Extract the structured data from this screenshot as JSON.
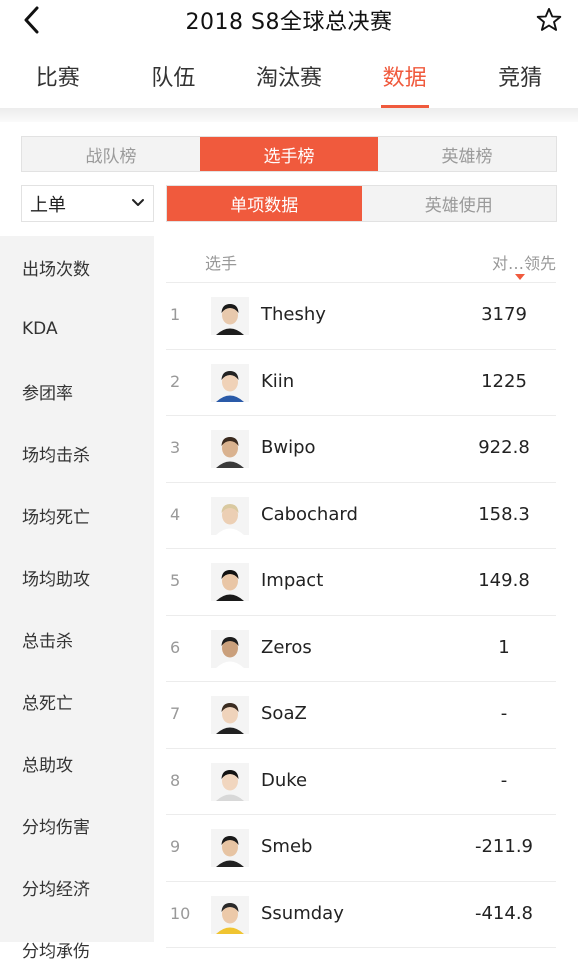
{
  "header": {
    "title": "2018 S8全球总决赛"
  },
  "main_tabs": [
    {
      "label": "比赛",
      "active": false
    },
    {
      "label": "队伍",
      "active": false
    },
    {
      "label": "淘汰赛",
      "active": false
    },
    {
      "label": "数据",
      "active": true
    },
    {
      "label": "竞猜",
      "active": false
    }
  ],
  "ranking_tabs": [
    {
      "label": "战队榜",
      "active": false
    },
    {
      "label": "选手榜",
      "active": true
    },
    {
      "label": "英雄榜",
      "active": false
    }
  ],
  "position_select": {
    "value": "上单"
  },
  "data_tabs": [
    {
      "label": "单项数据",
      "active": true
    },
    {
      "label": "英雄使用",
      "active": false
    }
  ],
  "categories": [
    "出场次数",
    "KDA",
    "参团率",
    "场均击杀",
    "场均死亡",
    "场均助攻",
    "总击杀",
    "总死亡",
    "总助攻",
    "分均伤害",
    "分均经济",
    "分均承伤"
  ],
  "table": {
    "player_header": "选手",
    "metric_header": "对…领先",
    "rows": [
      {
        "rank": "1",
        "name": "Theshy",
        "value": "3179"
      },
      {
        "rank": "2",
        "name": "Kiin",
        "value": "1225"
      },
      {
        "rank": "3",
        "name": "Bwipo",
        "value": "922.8"
      },
      {
        "rank": "4",
        "name": "Cabochard",
        "value": "158.3"
      },
      {
        "rank": "5",
        "name": "Impact",
        "value": "149.8"
      },
      {
        "rank": "6",
        "name": "Zeros",
        "value": "1"
      },
      {
        "rank": "7",
        "name": "SoaZ",
        "value": "-"
      },
      {
        "rank": "8",
        "name": "Duke",
        "value": "-"
      },
      {
        "rank": "9",
        "name": "Smeb",
        "value": "-211.9"
      },
      {
        "rank": "10",
        "name": "Ssumday",
        "value": "-414.8"
      }
    ]
  },
  "colors": {
    "accent": "#f05a3d",
    "panel": "#f3f3f3",
    "muted": "#999999"
  },
  "icons": {
    "back": "chevron-left-icon",
    "favorite": "star-outline-icon",
    "select": "chevron-down-icon"
  }
}
